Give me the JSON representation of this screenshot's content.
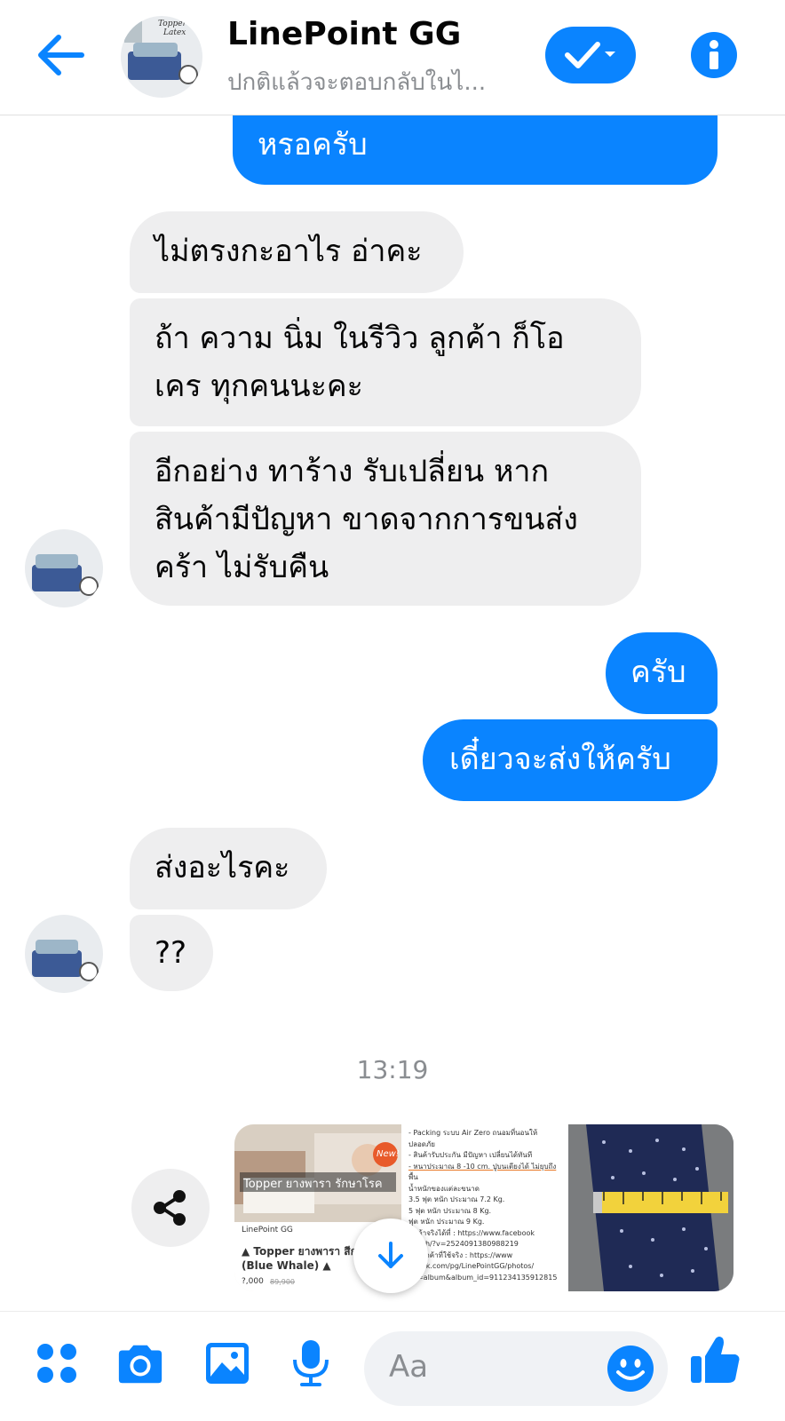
{
  "header": {
    "name": "LinePoint GG",
    "status": "ปกติแล้วจะตอบกลับในไ...",
    "avatar_text_line1": "Topper",
    "avatar_text_line2": "Latex"
  },
  "messages": [
    {
      "side": "out",
      "lines": [
        "หรอครับ"
      ]
    },
    {
      "side": "in",
      "lines": [
        "ไม่ตรงกะอาไร อ่าคะ"
      ]
    },
    {
      "side": "in",
      "lines": [
        "ถ้า ความ นิ่ม ในรีวิว ลูกค้า ก็โอ",
        "เคร ทุกคนนะคะ"
      ]
    },
    {
      "side": "in",
      "lines": [
        "อีกอย่าง ทาร้าง รับเปลี่ยน หาก",
        "สินค้ามีปัญหา ขาดจากการขนส่ง",
        "คร้า ไม่รับคืน"
      ]
    },
    {
      "side": "out",
      "lines": [
        "ครับ"
      ]
    },
    {
      "side": "out",
      "lines": [
        "เดี๋ยวจะส่งให้ครับ"
      ]
    },
    {
      "side": "in",
      "lines": [
        "ส่งอะไรคะ"
      ]
    },
    {
      "side": "in",
      "lines": [
        "??"
      ]
    }
  ],
  "timestamp": "13:19",
  "attachment": {
    "thumb1_banner": "Topper ยางพารา รักษาโรค",
    "thumb1_badge": "New!",
    "thumb1_page": "LinePoint GG",
    "thumb1_title": "▲ Topper ยางพารา สีก",
    "thumb1_subtitle": "(Blue Whale) ▲",
    "thumb1_price": "?,000",
    "thumb1_old_price": "89,900",
    "thumb2_lines": [
      "- Packing ระบบ Air Zero ถนอมที่นอนให้",
      "ปลอดภัย",
      "- สินค้ารับประกัน มีปัญหา เปลี่ยนได้ทันที",
      "- หนาประมาณ 8 -10 cm. ปูบนเตียงได้ ไม่ยุบถึง",
      "พื้น",
      "น้ำหนักของแต่ละขนาด",
      "3.5 ฟุต หนัก ประมาณ 7.2 Kg.",
      "5 ฟุต หนัก ประมาณ 8 Kg.",
      "ฟุต หนัก ประมาณ 9 Kg.",
      "สินค้าจริงได้ที่ : https://www.facebook",
      "watch/?v=2524091380988219",
      "จากลูกค้าที่ใช้จริง : https://www",
      "ebook.com/pg/LinePointGG/photos/",
      "ab=album&album_id=911234135912815"
    ]
  },
  "composer": {
    "placeholder": "Aa"
  },
  "colors": {
    "accent": "#0a84ff",
    "incoming_bubble": "#eeeeef",
    "muted_text": "#8a8d91"
  },
  "icons": [
    "back-arrow-icon",
    "check-chevron-icon",
    "info-icon",
    "share-icon",
    "down-arrow-icon",
    "apps-grid-icon",
    "camera-icon",
    "image-icon",
    "microphone-icon",
    "emoji-icon",
    "thumbs-up-icon"
  ]
}
